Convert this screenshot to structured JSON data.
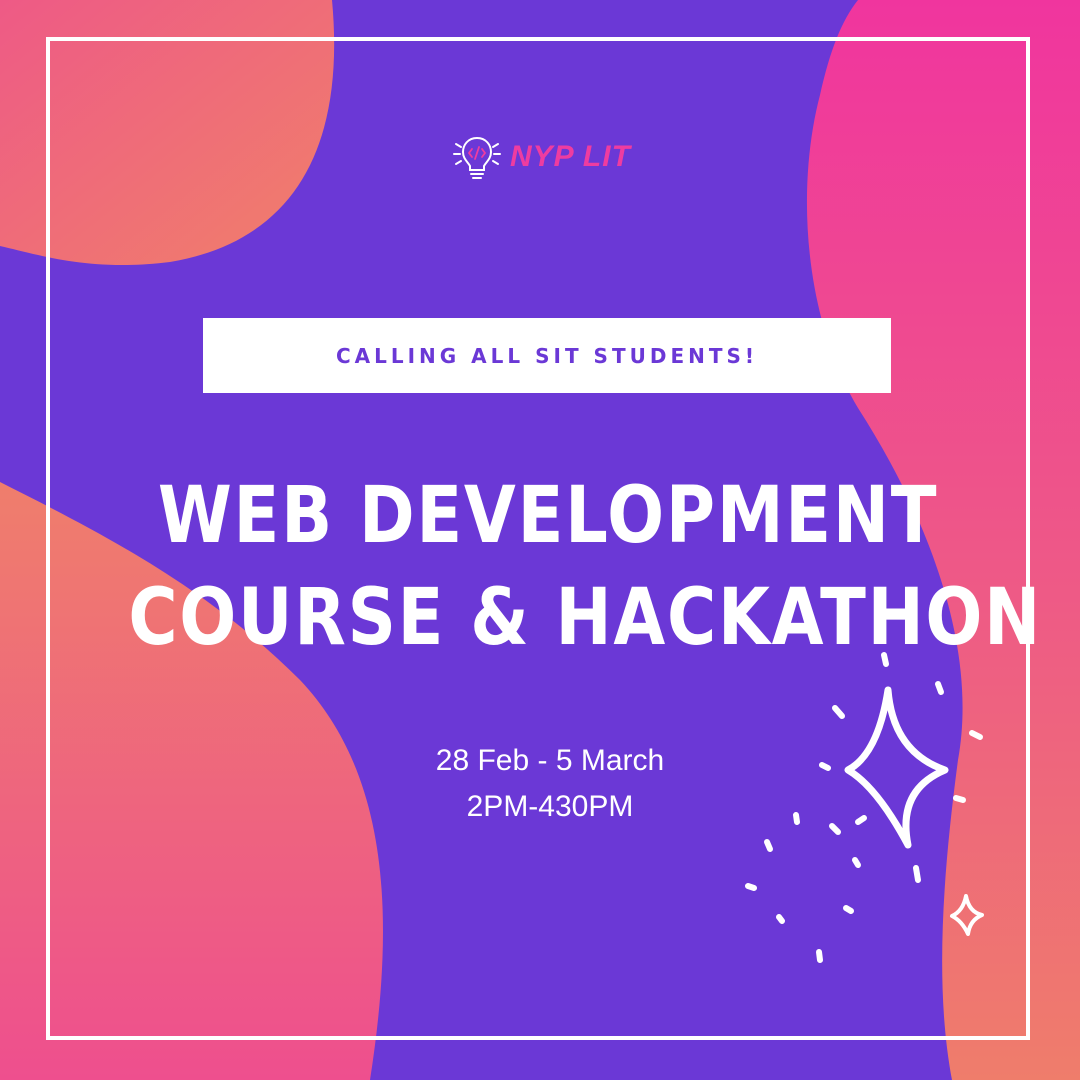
{
  "brand": {
    "logo_icon": "lightbulb-code-icon",
    "name": "NYP LIT"
  },
  "banner": {
    "text": "CALLING ALL SIT STUDENTS!"
  },
  "headline": {
    "line1": "WEB DEVELOPMENT",
    "line2": "COURSE & HACKATHON"
  },
  "details": {
    "dates": "28 Feb - 5 March",
    "time": "2PM-430PM"
  },
  "decor": {
    "sparkle_icon": "sparkle-icon"
  },
  "colors": {
    "background": "#6b38d6",
    "accent_pink": "#ee3ca0",
    "blob_orange": "#ef7d6b",
    "text": "#ffffff"
  }
}
